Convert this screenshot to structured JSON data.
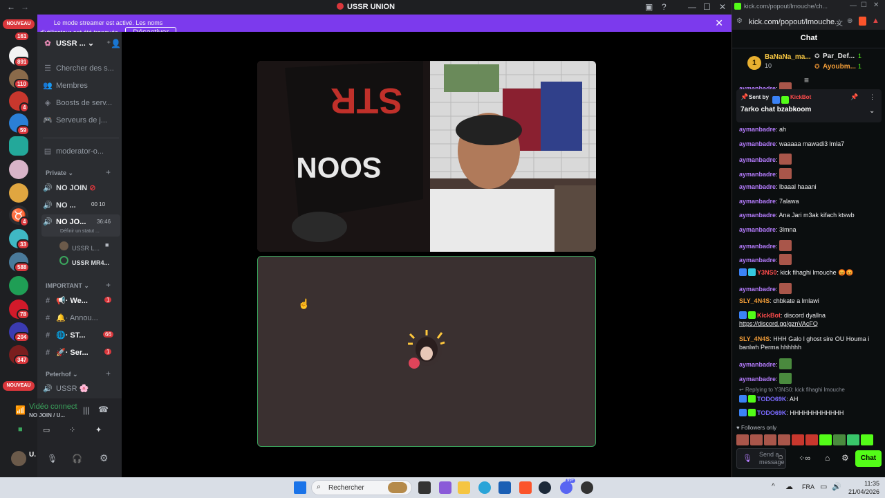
{
  "discord": {
    "window_title": "USSR UNION",
    "banner": {
      "message": "Le mode streamer est activé. Les noms d'utilisateur ont été tronqués.",
      "button": "Désactiver"
    },
    "rail": {
      "new_label": "NOUVEAU",
      "badges": [
        "161",
        "891",
        "110",
        "4",
        "59",
        "4",
        "33",
        "588",
        "78",
        "204",
        "347"
      ],
      "new_label_2": "NOUVEAU"
    },
    "server_name": "USSR ...",
    "menu": [
      "Chercher des s...",
      "Membres",
      "Boosts de serv...",
      "Serveurs de j...",
      "moderator-o..."
    ],
    "categories": {
      "private": "Private",
      "important": "IMPORTANT",
      "peterhof": "Peterhof"
    },
    "voice_channels": [
      {
        "name": "NO JOIN",
        "extra": ""
      },
      {
        "name": "NO ...",
        "extra": "00 10"
      },
      {
        "name": "NO JO...",
        "extra": "36:46",
        "status": "Définir un statut ..."
      }
    ],
    "voice_users": [
      "USSR L...",
      "USSR MR4..."
    ],
    "text_channels": [
      {
        "name": "· We...",
        "badge": "1"
      },
      {
        "name": "· Annou...",
        "badge": ""
      },
      {
        "name": "· ST...",
        "badge": "66"
      },
      {
        "name": "· Ser...",
        "badge": "1"
      }
    ],
    "peterhof_channel": "USSR",
    "voice_status": {
      "title": "Vidéo connect",
      "subtitle": "NO JOIN / U..."
    },
    "user_tag": "U."
  },
  "browser": {
    "tab_url": "kick.com/popout/lmouche/ch...",
    "address": "kick.com/popout/lmouche...",
    "chat_title": "Chat",
    "leaderboard": {
      "first_name": "BaNaNa_ma...",
      "first_count": "10",
      "second_name": "Par_Def...",
      "second_count": "1",
      "third_name": "Ayoubm...",
      "third_count": "1"
    },
    "pinned": {
      "sent_by": "Sent by",
      "bot": "KickBot",
      "text": "7arko chat bzabkoom"
    },
    "messages": [
      {
        "user": "aymanbadre",
        "text": ": ah",
        "cls": "u-purple",
        "emote": ""
      },
      {
        "user": "aymanbadre",
        "text": ": waaaaa mawadi3 lmla7",
        "cls": "u-purple",
        "emote": ""
      },
      {
        "user": "aymanbadre",
        "text": ":",
        "cls": "u-purple",
        "emote": "r"
      },
      {
        "user": "aymanbadre",
        "text": ":",
        "cls": "u-purple",
        "emote": "r"
      },
      {
        "user": "aymanbadre",
        "text": ": lbaaal haaani",
        "cls": "u-purple",
        "emote": ""
      },
      {
        "user": "aymanbadre",
        "text": ": 7alawa",
        "cls": "u-purple",
        "emote": ""
      },
      {
        "user": "aymanbadre",
        "text": ": Ana Jari m3ak kifach ktswb",
        "cls": "u-purple",
        "emote": ""
      },
      {
        "user": "aymanbadre",
        "text": ": 3lmna",
        "cls": "u-purple",
        "emote": ""
      },
      {
        "user": "aymanbadre",
        "text": ":",
        "cls": "u-purple",
        "emote": "r"
      },
      {
        "user": "aymanbadre",
        "text": ":",
        "cls": "u-purple",
        "emote": "r"
      },
      {
        "user": "Y3NS0",
        "text": ": kick fihaghi lmouche",
        "cls": "u-red",
        "emote": ""
      },
      {
        "user": "aymanbadre",
        "text": ":",
        "cls": "u-purple",
        "emote": "r"
      },
      {
        "user": "SLY_4N4S",
        "text": ": chbkate a lmlawi",
        "cls": "u-orange",
        "emote": ""
      }
    ],
    "kickbot_msg": {
      "user": "KickBot",
      "text": ": discord dyallna",
      "link": "https://discord.gg/gznVAcFQ"
    },
    "sly_msg": {
      "user": "SLY_4N4S",
      "text": ": HHH Galo l ghost sire OU Houma i banlwh Perma hhhhhh"
    },
    "late_messages": [
      {
        "user": "aymanbadre",
        "text": ":"
      },
      {
        "user": "aymanbadre",
        "text": ":"
      }
    ],
    "reply_hint": "Replying to Y3NS0: kick fihaghi lmouche",
    "todo_messages": [
      {
        "user": "TODO69K",
        "text": ": AH"
      },
      {
        "user": "TODO69K",
        "text": ": HHHHHHHHHHHH"
      }
    ],
    "followers_only": "Followers only",
    "composer_placeholder": "Send a message",
    "chat_button": "Chat"
  },
  "taskbar": {
    "search": "Rechercher",
    "lang": "FRA",
    "time": "11:35",
    "date": "21/04/2026",
    "notif": "99+"
  }
}
